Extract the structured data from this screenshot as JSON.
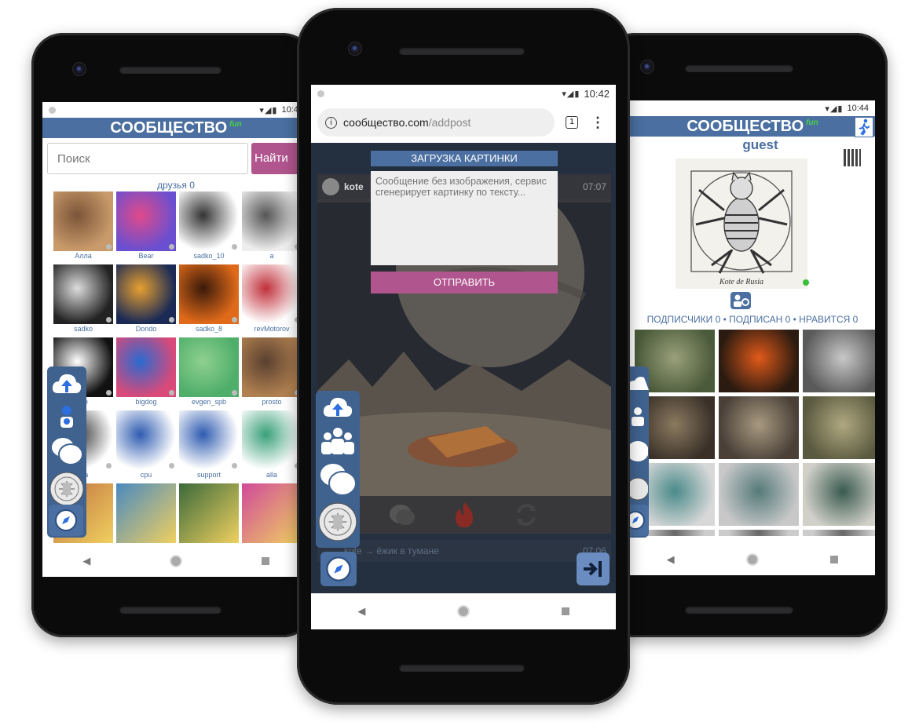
{
  "left_phone": {
    "status": {
      "time": "10:43",
      "icons": "▾◢▮"
    },
    "header": {
      "title": "СООБЩЕСТВО",
      "badge": "fun"
    },
    "search": {
      "placeholder": "Поиск",
      "button": "Найти"
    },
    "friends_label": "друзья 0",
    "users": [
      "Алла",
      "Bear",
      "sadko_10",
      "a",
      "sadko",
      "Dondo",
      "sadko_8",
      "revMotorov",
      "ste",
      "bigdog",
      "evgen_spb",
      "prosto",
      "ma",
      "cpu",
      "support",
      "alla"
    ],
    "nav": {
      "back": "◀"
    }
  },
  "center_phone": {
    "status": {
      "time": "10:42",
      "icons": "▾◢▮"
    },
    "browser": {
      "url_host": "сообщество.com",
      "url_path": "/addpost",
      "tabs": "1",
      "menu": "⋮"
    },
    "upload_title": "ЗАГРУЗКА КАРТИНКИ",
    "textarea_placeholder": "Сообщение без изображения, сервис сгенерирует картинку по тексту...",
    "submit": "ОТПРАВИТЬ",
    "post": {
      "author": "kote",
      "time": "07:07"
    },
    "post2": {
      "text": "kote → ёжик в тумане",
      "time": "07:06"
    },
    "nav": {
      "back": "◀"
    }
  },
  "right_phone": {
    "status": {
      "time": "10:44",
      "icons": "▾◢▮"
    },
    "header": {
      "title": "СООБЩЕСТВО",
      "badge": "fun"
    },
    "profile_name": "guest",
    "avatar_caption": "Kote de Rusia",
    "stats": "ПОДПИСЧИКИ 0 • ПОДПИСАН 0 • НРАВИТСЯ 0",
    "nav": {
      "back": "◀"
    }
  },
  "colors": {
    "header_blue": "#4a6fa0",
    "submit_purple": "#b0558e",
    "online_green": "#3bbf3b"
  }
}
